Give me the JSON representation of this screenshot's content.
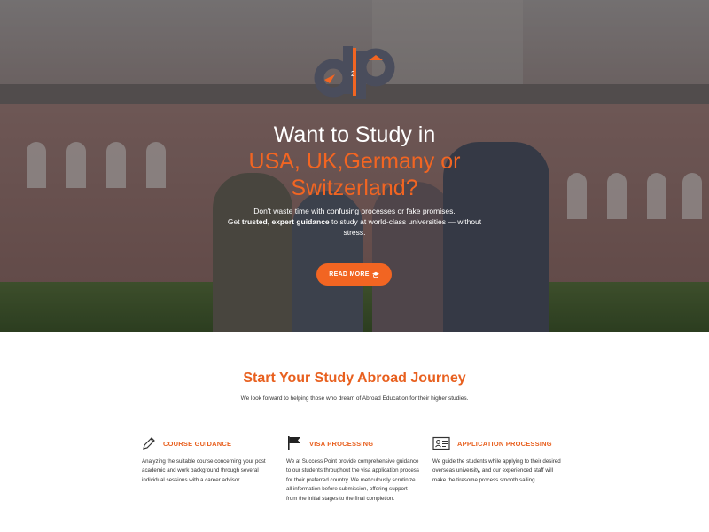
{
  "hero": {
    "title_line1": "Want to Study in",
    "title_line2": "USA, UK,Germany  or",
    "title_line3": "Switzerland?",
    "sub_line1": "Don't waste time with confusing processes or fake promises.",
    "sub_get": "Get ",
    "sub_bold1": "trusted",
    "sub_comma": ", ",
    "sub_bold2": "expert guidance",
    "sub_rest": " to study at world-class universities — without stress.",
    "button_label": "READ MORE",
    "logo_number": "2"
  },
  "section": {
    "title": "Start Your Study Abroad Journey",
    "subtitle": "We look forward to helping those who dream of Abroad Education for their higher studies."
  },
  "features": [
    {
      "icon": "pencil-icon",
      "title": "COURSE GUIDANCE",
      "body": "Analyzing the suitable course concerning your post academic and work background through several individual sessions with a career advisor."
    },
    {
      "icon": "flag-icon",
      "title": "VISA PROCESSING",
      "body": "We at Success Point provide comprehensive guidance to our students throughout the visa application process for their preferred country. We meticulously scrutinize all information before submission, offering support from the initial stages to the final completion."
    },
    {
      "icon": "id-card-icon",
      "title": "APPLICATION PROCESSING",
      "body": "We guide the students while applying to their desired overseas university, and our experienced staff will make the tiresome process smooth sailing."
    }
  ],
  "colors": {
    "accent": "#f26522",
    "logo_dark": "#4a4d5c"
  }
}
